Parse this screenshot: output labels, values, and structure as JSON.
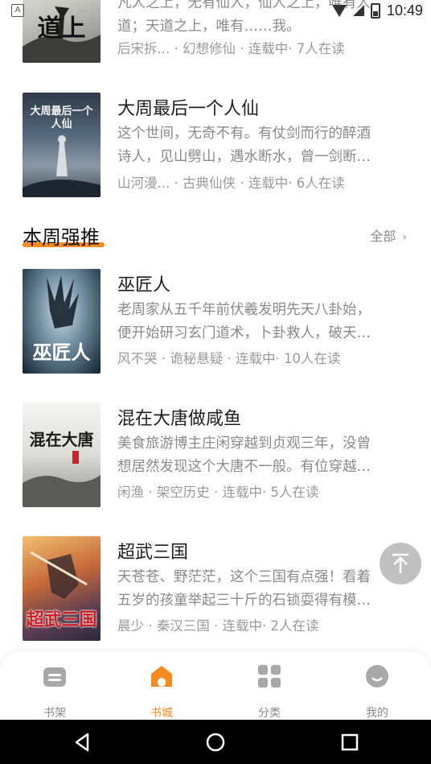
{
  "status_bar": {
    "time": "10:49",
    "left_glyph": "A",
    "icons": [
      "wifi-icon",
      "signal-icon",
      "battery-icon"
    ]
  },
  "books_top": [
    {
      "cover_text": "道上",
      "desc_lines": [
        "凡人之上，无有仙人，仙人之上，唯有人",
        "道；天道之上，唯有……我。"
      ],
      "meta": "后宋拆... · 幻想修仙 · 连载中· 7人在读"
    },
    {
      "title": "大周最后一个人仙",
      "cover_text": "大周最后一个人仙",
      "desc_lines": [
        "这个世间，无奇不有。有仗剑而行的醉酒",
        "诗人，见山劈山，遇水断水，曾一剑断…"
      ],
      "meta": "山河漫... · 古典仙侠 · 连载中· 6人在读"
    }
  ],
  "section": {
    "title": "本周强推",
    "more_label": "全部",
    "more_icon": "chevron-right-icon"
  },
  "books": [
    {
      "title": "巫匠人",
      "cover_text": "巫匠人",
      "desc_lines": [
        "老周家从五千年前伏羲发明先天八卦始，",
        "便开始研习玄门道术，卜卦救人，破天…"
      ],
      "meta": "风不哭 · 诡秘悬疑 · 连载中· 10人在读"
    },
    {
      "title": "混在大唐做咸鱼",
      "cover_text": "混在大唐",
      "desc_lines": [
        "美食旅游博主庄闲穿越到贞观三年，没曾",
        "想居然发现这个大唐不一般。有位穿越…"
      ],
      "meta": "闲渔 · 架空历史 · 连载中· 5人在读"
    },
    {
      "title": "超武三国",
      "cover_text": "超武三国",
      "desc_lines": [
        "天苍苍、野茫茫，这个三国有点强！看着",
        "五岁的孩童举起三十斤的石锁耍得有模…"
      ],
      "meta": "晨少 · 秦汉三国 · 连载中· 2人在读"
    }
  ],
  "tabs": [
    {
      "label": "书架",
      "icon": "bookshelf-icon",
      "active": false
    },
    {
      "label": "书城",
      "icon": "bookstore-icon",
      "active": true
    },
    {
      "label": "分类",
      "icon": "category-icon",
      "active": false
    },
    {
      "label": "我的",
      "icon": "profile-icon",
      "active": false
    }
  ],
  "colors": {
    "accent": "#f58a22",
    "muted": "#8a8a8a",
    "title": "#1e1e1e",
    "tab_inactive": "#a8a8a8"
  },
  "nav_icons": [
    "back-icon",
    "home-icon",
    "recents-icon"
  ]
}
